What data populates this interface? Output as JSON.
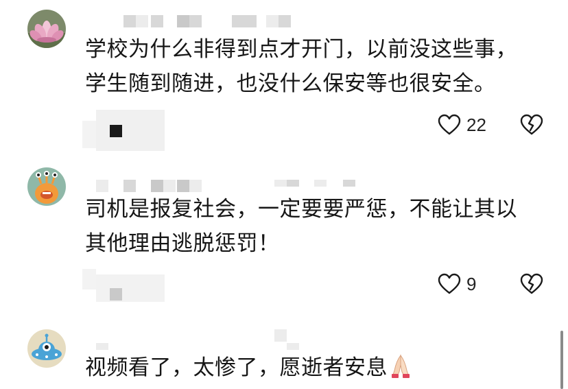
{
  "comments": [
    {
      "text_line1": "学校为什么非得到点才开门，以前没这些事，",
      "text_line2": "学生随到随进，也没什么保安等也很安全。",
      "likes": "22",
      "avatar_icon": "lotus-flower-avatar"
    },
    {
      "text_line1": "司机是报复社会，一定要要严惩，不能让其以",
      "text_line2": "其他理由逃脱惩罚！",
      "likes": "9",
      "avatar_icon": "cartoon-monster-avatar"
    },
    {
      "text_line1": "视频看了，太惨了，愿逝者安息",
      "emoji": "praying-hands-emoji",
      "avatar_icon": "blue-alien-ufo-avatar"
    }
  ],
  "icons": {
    "like": "heart-outline-icon",
    "dislike": "broken-heart-icon"
  },
  "colors": {
    "text": "#161616",
    "blur_gray": "#d8d8d8",
    "background": "#ffffff"
  }
}
